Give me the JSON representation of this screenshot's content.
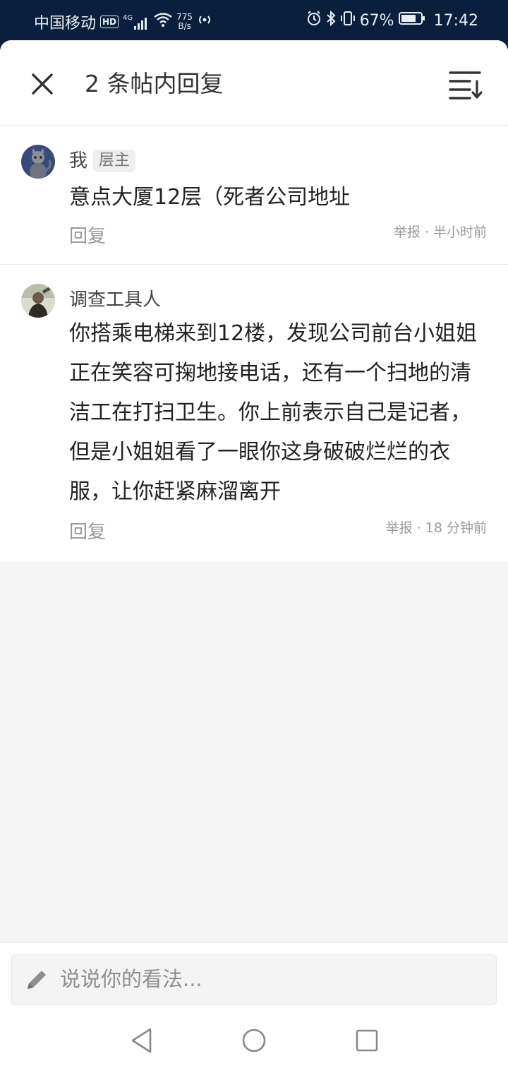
{
  "status_bar": {
    "carrier": "中国移动",
    "hd": "HD",
    "network": "4G",
    "speed_value": "775",
    "speed_unit": "B/s",
    "battery": "67%",
    "time": "17:42"
  },
  "header": {
    "title": "2 条帖内回复",
    "close_icon": "close-icon",
    "sort_icon": "sort-icon"
  },
  "replies": [
    {
      "author": "我",
      "badge": "层主",
      "content": "意点大厦12层（死者公司地址",
      "reply_label": "回复",
      "report_label": "举报",
      "time": "半小时前"
    },
    {
      "author": "调查工具人",
      "content": "你搭乘电梯来到12楼，发现公司前台小姐姐正在笑容可掬地接电话，还有一个扫地的清洁工在打扫卫生。你上前表示自己是记者，但是小姐姐看了一眼你这身破破烂烂的衣服，让你赶紧麻溜离开",
      "reply_label": "回复",
      "report_label": "举报",
      "time": "18 分钟前"
    }
  ],
  "comment_input": {
    "placeholder": "说说你的看法..."
  },
  "meta_separator": " · ",
  "colors": {
    "status_bar_bg": "#0a1f3c",
    "sheet_bg": "#f5f5f5",
    "text_primary": "#222222",
    "text_secondary": "#999999"
  }
}
